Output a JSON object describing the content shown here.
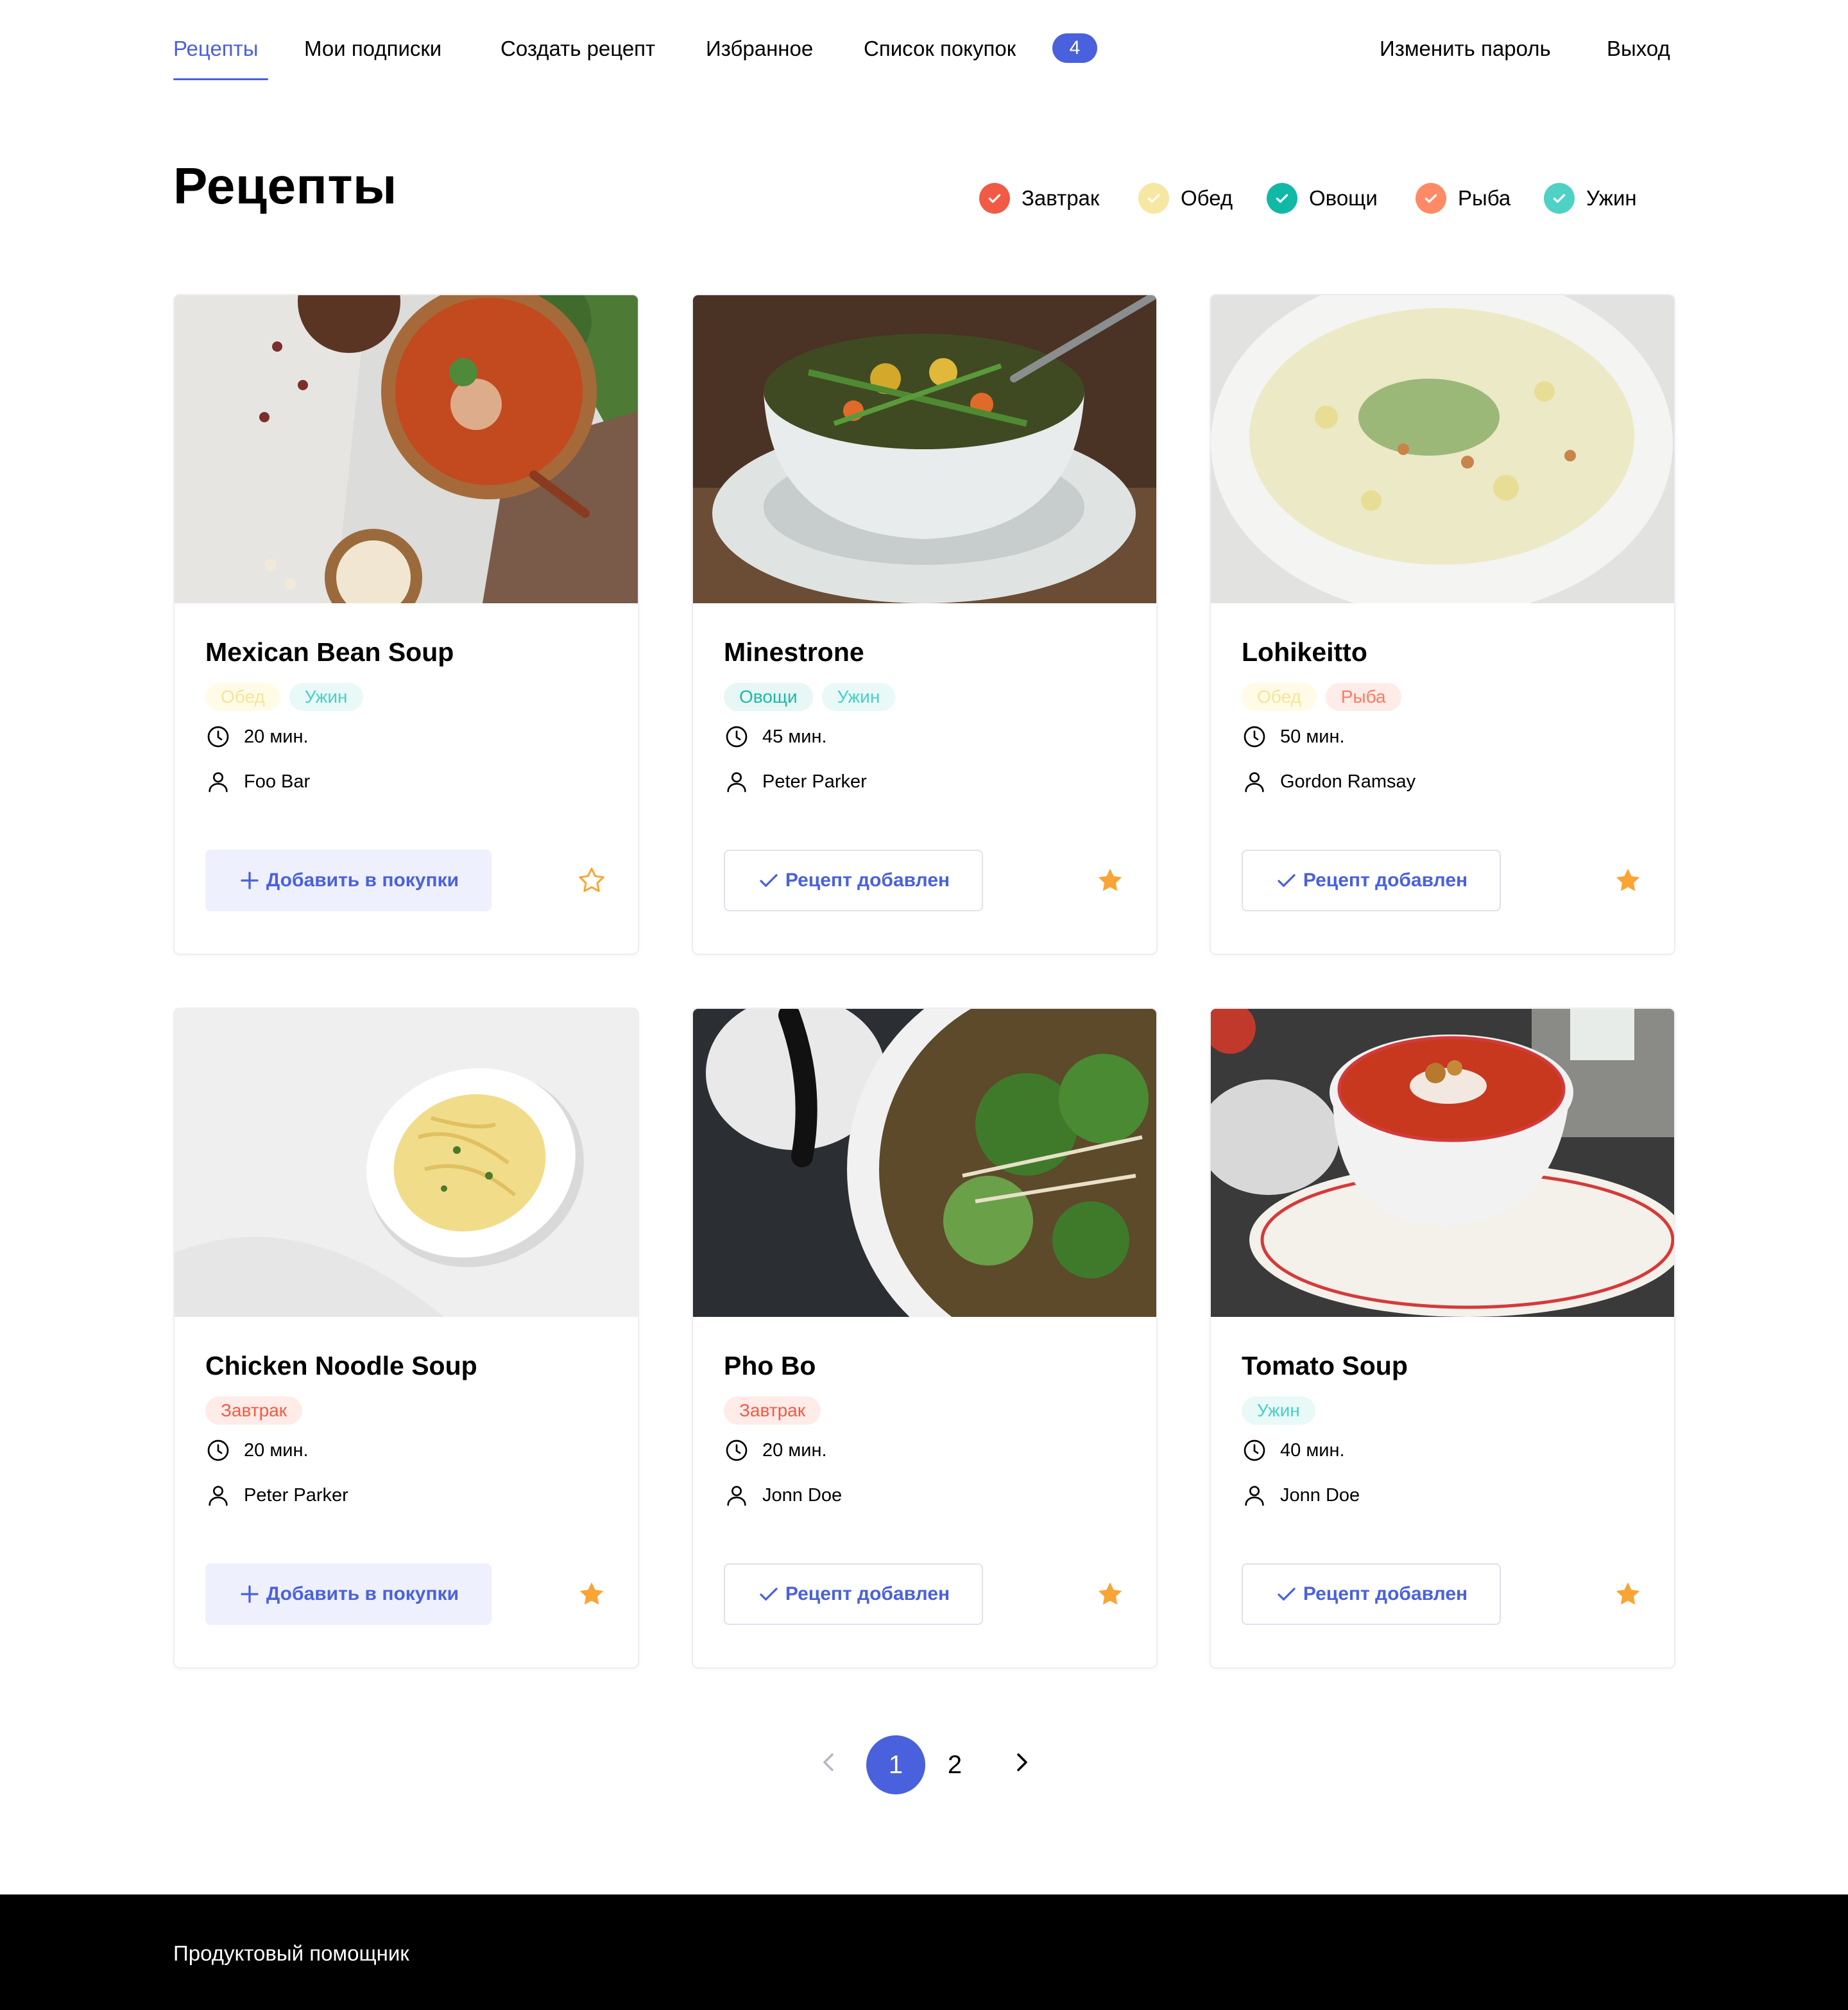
{
  "nav": {
    "items": [
      {
        "label": "Рецепты",
        "active": true
      },
      {
        "label": "Мои подписки"
      },
      {
        "label": "Создать рецепт"
      },
      {
        "label": "Избранное"
      },
      {
        "label": "Список покупок"
      }
    ],
    "cart_count": "4",
    "change_password": "Изменить пароль",
    "logout": "Выход"
  },
  "page": {
    "title": "Рецепты"
  },
  "filters": [
    {
      "label": "Завтрак",
      "color": "#f15a44",
      "checked": true
    },
    {
      "label": "Обед",
      "color": "#f6e7a2",
      "checked": true
    },
    {
      "label": "Овощи",
      "color": "#12b8a6",
      "checked": true
    },
    {
      "label": "Рыба",
      "color": "#ff8a65",
      "checked": true
    },
    {
      "label": "Ужин",
      "color": "#4fd1c5",
      "checked": true
    }
  ],
  "recipes": [
    {
      "title": "Mexican Bean Soup",
      "tags": [
        "Обед",
        "Ужин"
      ],
      "time": "20 мин.",
      "author": "Foo Bar",
      "button": "Добавить в покупки",
      "in_cart": false,
      "favorite": false
    },
    {
      "title": "Minestrone",
      "tags": [
        "Овощи",
        "Ужин"
      ],
      "time": "45 мин.",
      "author": "Peter Parker",
      "button": "Рецепт добавлен",
      "in_cart": true,
      "favorite": true
    },
    {
      "title": "Lohikeitto",
      "tags": [
        "Обед",
        "Рыба"
      ],
      "time": "50 мин.",
      "author": "Gordon Ramsay",
      "button": "Рецепт добавлен",
      "in_cart": true,
      "favorite": true
    },
    {
      "title": "Chicken Noodle Soup",
      "tags": [
        "Завтрак"
      ],
      "time": "20 мин.",
      "author": "Peter Parker",
      "button": "Добавить в покупки",
      "in_cart": false,
      "favorite": true
    },
    {
      "title": "Pho Bo",
      "tags": [
        "Завтрак"
      ],
      "time": "20 мин.",
      "author": "Jonn Doe",
      "button": "Рецепт добавлен",
      "in_cart": true,
      "favorite": true
    },
    {
      "title": "Tomato Soup",
      "tags": [
        "Ужин"
      ],
      "time": "40 мин.",
      "author": "Jonn Doe",
      "button": "Рецепт добавлен",
      "in_cart": true,
      "favorite": true
    }
  ],
  "pagination": {
    "pages": [
      "1",
      "2"
    ],
    "current": "1"
  },
  "footer": {
    "text": "Продуктовый помощник"
  },
  "colors": {
    "accent": "#4a61dd",
    "star": "#f8a535"
  }
}
